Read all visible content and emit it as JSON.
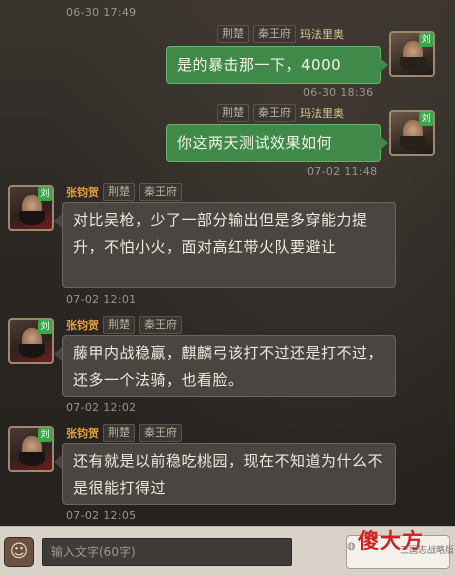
{
  "messages": [
    {
      "side": "right",
      "tags": [
        "荆楚",
        "秦王府"
      ],
      "name": "玛法里奥",
      "avatar": "elder-general-avatar",
      "badge": "刘",
      "text": "是的暴击那一下，4000",
      "time_after": "06-30 18:36"
    },
    {
      "side": "right",
      "tags": [
        "荆楚",
        "秦王府"
      ],
      "name": "玛法里奥",
      "avatar": "elder-general-avatar",
      "badge": "刘",
      "text": "你这两天测试效果如何",
      "time_after": "07-02 11:48"
    },
    {
      "side": "left",
      "name": "张钧贺",
      "tags": [
        "荆楚",
        "秦王府"
      ],
      "avatar": "warrior-avatar",
      "badge": "刘",
      "text": "对比吴枪，少了一部分输出但是多穿能力提升，不怕小火，面对高红带火队要避让",
      "time_after": "07-02 12:01"
    },
    {
      "side": "left",
      "name": "张钧贺",
      "tags": [
        "荆楚",
        "秦王府"
      ],
      "avatar": "warrior-avatar",
      "badge": "刘",
      "text": "藤甲内战稳赢，麒麟弓该打不过还是打不过，还多一个法骑，也看脸。",
      "time_after": "07-02 12:02"
    },
    {
      "side": "left",
      "name": "张钧贺",
      "tags": [
        "荆楚",
        "秦王府"
      ],
      "avatar": "warrior-avatar",
      "badge": "刘",
      "text": "还有就是以前稳吃桃园，现在不知道为什么不是很能打得过",
      "time_after": "07-02 12:05"
    }
  ],
  "top_timestamp": "06-30 17:49",
  "input": {
    "placeholder": "输入文字(60字)",
    "emoji_icon": "smiley-icon"
  },
  "watermark": {
    "brand": "傻大方",
    "sub": "三国志战略版"
  },
  "colors": {
    "green_bubble": "#3f8a49",
    "dark_bubble": "#4b4541",
    "name_orange": "#e0a040",
    "badge_green": "#3aa84a"
  }
}
